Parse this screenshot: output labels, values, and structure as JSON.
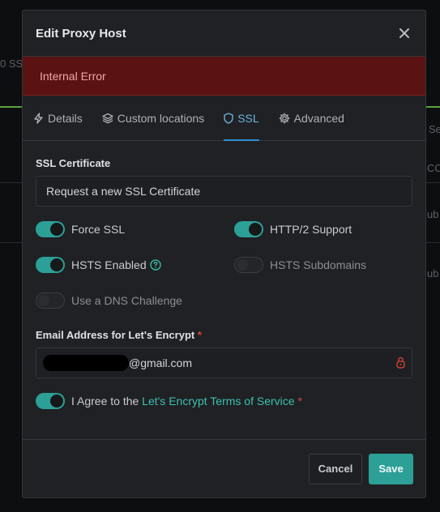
{
  "background": {
    "frag_ssl": "0 SSL",
    "frag_se": "Se",
    "frag_cc": "CC",
    "frag_ub1": "ub",
    "frag_ub2": "ub"
  },
  "modal": {
    "title": "Edit Proxy Host",
    "close_icon": "close-icon",
    "alert": "Internal Error"
  },
  "tabs": [
    {
      "label": "Details",
      "icon": "bolt-icon"
    },
    {
      "label": "Custom locations",
      "icon": "layers-icon"
    },
    {
      "label": "SSL",
      "icon": "shield-icon",
      "active": true
    },
    {
      "label": "Advanced",
      "icon": "gear-icon"
    }
  ],
  "ssl": {
    "certificate_label": "SSL Certificate",
    "certificate_value": "Request a new SSL Certificate",
    "toggles": {
      "force_ssl": {
        "label": "Force SSL",
        "on": true
      },
      "http2": {
        "label": "HTTP/2 Support",
        "on": true
      },
      "hsts": {
        "label": "HSTS Enabled",
        "on": true
      },
      "hsts_sub": {
        "label": "HSTS Subdomains",
        "on": false
      },
      "dns": {
        "label": "Use a DNS Challenge",
        "on": false
      }
    },
    "email_label": "Email Address for Let's Encrypt",
    "required_mark": "*",
    "email_value": "@gmail.com",
    "agree": {
      "prefix": "I Agree to the ",
      "link": "Let's Encrypt Terms of Service",
      "on": true
    }
  },
  "footer": {
    "cancel": "Cancel",
    "save": "Save"
  },
  "colors": {
    "accent": "#2c9f96",
    "link": "#3ec0b0",
    "alert_bg": "#5a1212",
    "active_tab": "#6cb3e0"
  }
}
